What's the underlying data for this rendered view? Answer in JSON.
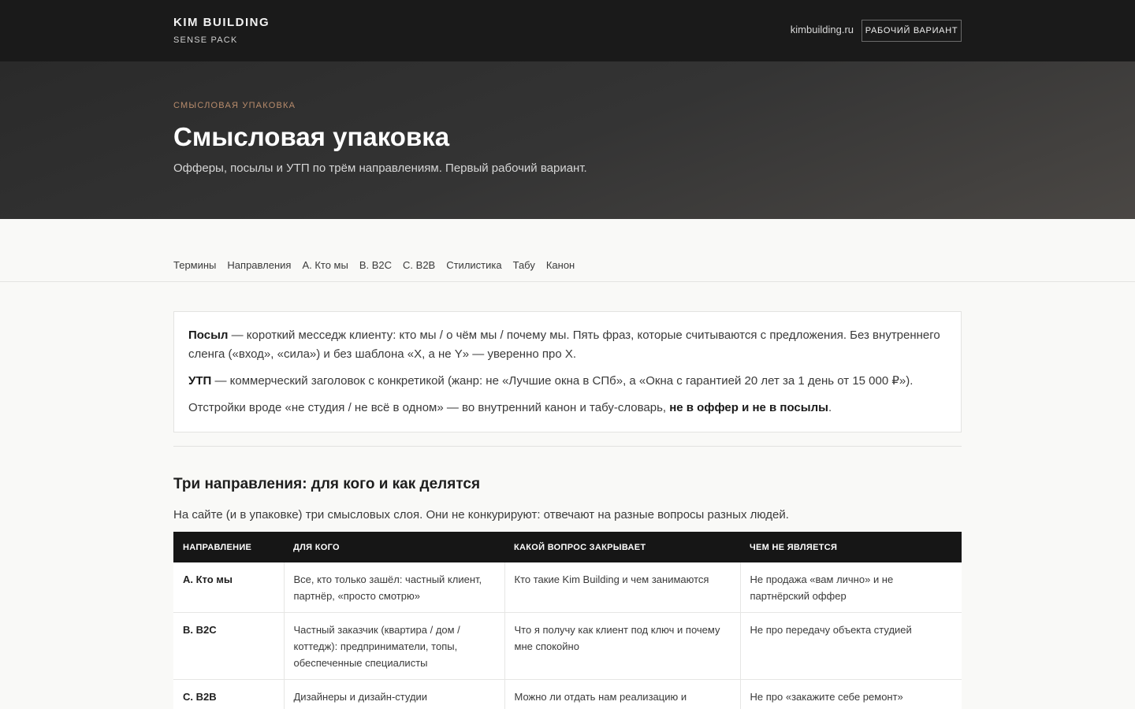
{
  "header": {
    "brand_name": "KIM BUILDING",
    "brand_sub": "SENSE PACK",
    "site_link": "kimbuilding.ru",
    "badge": "РАБОЧИЙ ВАРИАНТ"
  },
  "hero": {
    "eyebrow": "СМЫСЛОВАЯ УПАКОВКА",
    "title": "Смысловая упаковка",
    "subtitle": "Офферы, посылы и УТП по трём направлениям. Первый рабочий вариант."
  },
  "nav": {
    "items": [
      {
        "label": "Термины"
      },
      {
        "label": "Направления"
      },
      {
        "label": "A. Кто мы"
      },
      {
        "label": "B. B2C"
      },
      {
        "label": "C. B2B"
      },
      {
        "label": "Стилистика"
      },
      {
        "label": "Табу"
      },
      {
        "label": "Канон"
      }
    ]
  },
  "definitions": {
    "posyl_term": "Посыл",
    "posyl_text": " — короткий месседж клиенту: кто мы / о чём мы / почему мы. Пять фраз, которые считываются с предложения. Без внутреннего сленга («вход», «сила») и без шаблона «X, а не Y» — уверенно про X.",
    "utp_term": "УТП",
    "utp_text": " — коммерческий заголовок с конкретикой (жанр: не «Лучшие окна в СПб», а «Окна с гарантией 20 лет за 1 день от 15 000 ₽»).",
    "note_text": "Отстройки вроде «не студия / не всё в одном» — во внутренний канон и табу-словарь, ",
    "note_bold": "не в оффер и не в посылы",
    "note_end": "."
  },
  "directions": {
    "title": "Три направления: для кого и как делятся",
    "lead": "На сайте (и в упаковке) три смысловых слоя. Они не конкурируют: отвечают на разные вопросы разных людей.",
    "headers": [
      "НАПРАВЛЕНИЕ",
      "ДЛЯ КОГО",
      "КАКОЙ ВОПРОС ЗАКРЫВАЕТ",
      "ЧЕМ НЕ ЯВЛЯЕТСЯ"
    ],
    "rows": [
      {
        "direction": "A. Кто мы",
        "audience": "Все, кто только зашёл: частный клиент, партнёр, «просто смотрю»",
        "question": "Кто такие Kim Building и чем занимаются",
        "not": "Не продажа «вам лично» и не партнёрский оффер"
      },
      {
        "direction": "B. B2C",
        "audience": "Частный заказчик (квартира / дом / коттедж): предприниматели, топы, обеспеченные специалисты",
        "question": "Что я получу как клиент под ключ и почему мне спокойно",
        "not": "Не про передачу объекта студией"
      },
      {
        "direction": "C. B2B",
        "audience": "Дизайнеры и дизайн-студии",
        "question": "Можно ли отдать нам реализацию и сохранить авторский",
        "not": "Не про «закажите себе ремонт»"
      }
    ]
  }
}
